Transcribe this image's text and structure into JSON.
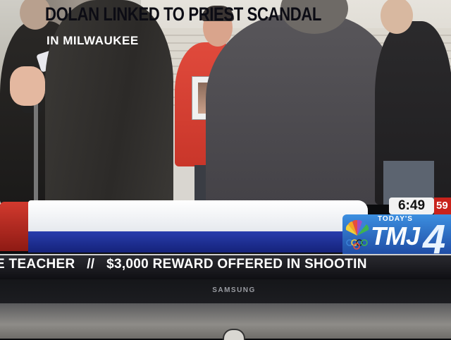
{
  "broadcast": {
    "headline": "DOLAN LINKED TO PRIEST SCANDAL",
    "subhead": "IN MILWAUKEE",
    "time": "6:49",
    "temperature": "59",
    "station_tagline": "TODAY'S",
    "station_name": "TMJ",
    "station_number": "4",
    "ticker": "E TEACHER   //   $3,000 REWARD OFFERED IN SHOOTIN"
  },
  "tv": {
    "brand": "SAMSUNG"
  },
  "icons": {
    "network_logo": "nbc-peacock-icon",
    "power_button": "power-icon"
  },
  "colors": {
    "headline_bar": "#ffffff",
    "subhead_bar": "#1f2f95",
    "accent_red": "#c8231c",
    "logo_blue": "#2a6fcf"
  }
}
